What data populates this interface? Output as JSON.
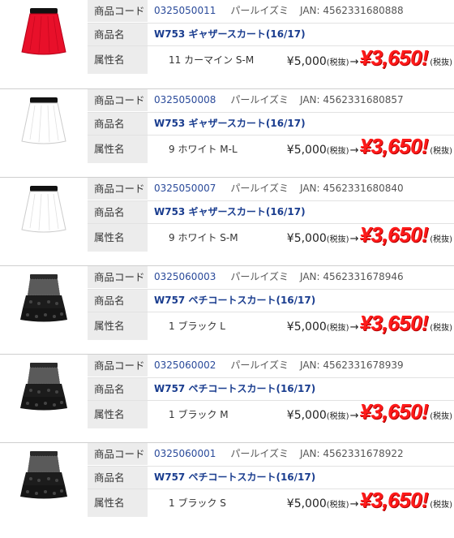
{
  "labels": {
    "code": "商品コード",
    "name": "商品名",
    "attr": "属性名"
  },
  "brand": "パールイズミ",
  "jan_prefix": "JAN: ",
  "price": {
    "original": "¥5,000",
    "tax_note": "(税抜)",
    "arrow": "→",
    "sale": "¥3,650!"
  },
  "colors": {
    "sale_red": "#ff1a1a",
    "name_blue": "#1a3d8f"
  },
  "items": [
    {
      "code": "0325050011",
      "jan": "4562331680888",
      "name": "W753 ギャザースカート(16/17)",
      "attr": "11 カーマイン S-M",
      "image": "red-gather-skirt-icon"
    },
    {
      "code": "0325050008",
      "jan": "4562331680857",
      "name": "W753 ギャザースカート(16/17)",
      "attr": "9 ホワイト M-L",
      "image": "white-gather-skirt-icon"
    },
    {
      "code": "0325050007",
      "jan": "4562331680840",
      "name": "W753 ギャザースカート(16/17)",
      "attr": "9 ホワイト S-M",
      "image": "white-gather-skirt-icon"
    },
    {
      "code": "0325060003",
      "jan": "4562331678946",
      "name": "W757 ペチコートスカート(16/17)",
      "attr": "1 ブラック L",
      "image": "black-petticoat-skirt-icon"
    },
    {
      "code": "0325060002",
      "jan": "4562331678939",
      "name": "W757 ペチコートスカート(16/17)",
      "attr": "1 ブラック M",
      "image": "black-petticoat-skirt-icon"
    },
    {
      "code": "0325060001",
      "jan": "4562331678922",
      "name": "W757 ペチコートスカート(16/17)",
      "attr": "1 ブラック S",
      "image": "black-petticoat-skirt-icon"
    }
  ]
}
